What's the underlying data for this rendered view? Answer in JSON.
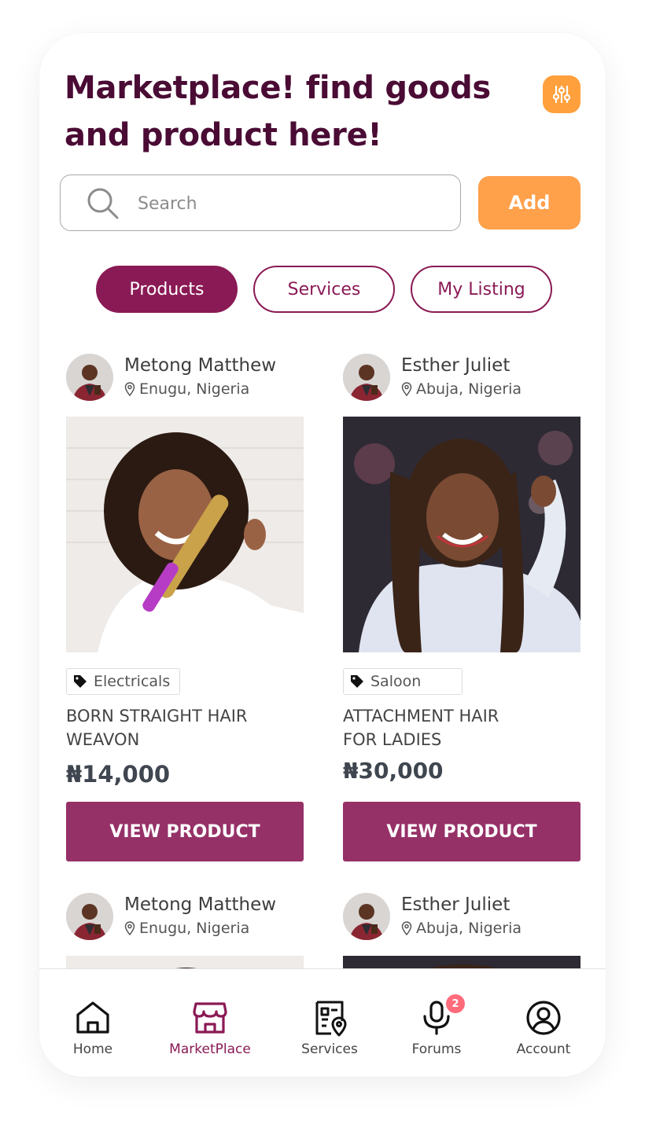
{
  "header": {
    "title": "Marketplace! find goods and product here!"
  },
  "search": {
    "placeholder": "Search",
    "add_label": "Add"
  },
  "tabs": [
    {
      "label": "Products",
      "active": true
    },
    {
      "label": "Services",
      "active": false
    },
    {
      "label": "My Listing",
      "active": false
    }
  ],
  "products": [
    {
      "seller": "Metong Matthew",
      "location": "Enugu, Nigeria",
      "category": "Electricals",
      "title": "BORN STRAIGHT HAIR WEAVON",
      "price": "₦14,000",
      "button": "VIEW PRODUCT"
    },
    {
      "seller": "Esther Juliet",
      "location": "Abuja, Nigeria",
      "category": "Saloon",
      "title": "ATTACHMENT HAIR FOR LADIES",
      "price": "₦30,000",
      "button": "VIEW PRODUCT"
    },
    {
      "seller": "Metong Matthew",
      "location": "Enugu, Nigeria"
    },
    {
      "seller": "Esther Juliet",
      "location": "Abuja, Nigeria"
    }
  ],
  "nav": {
    "items": [
      {
        "label": "Home",
        "icon": "home-icon"
      },
      {
        "label": "MarketPlace",
        "icon": "store-icon",
        "active": true
      },
      {
        "label": "Services",
        "icon": "services-icon"
      },
      {
        "label": "Forums",
        "icon": "microphone-icon",
        "badge": "2"
      },
      {
        "label": "Account",
        "icon": "account-icon"
      }
    ]
  },
  "colors": {
    "primary": "#8a1a55",
    "accent": "#ffa04b",
    "button": "#963168",
    "title": "#4a0b34",
    "badge": "#ff6b7a"
  }
}
